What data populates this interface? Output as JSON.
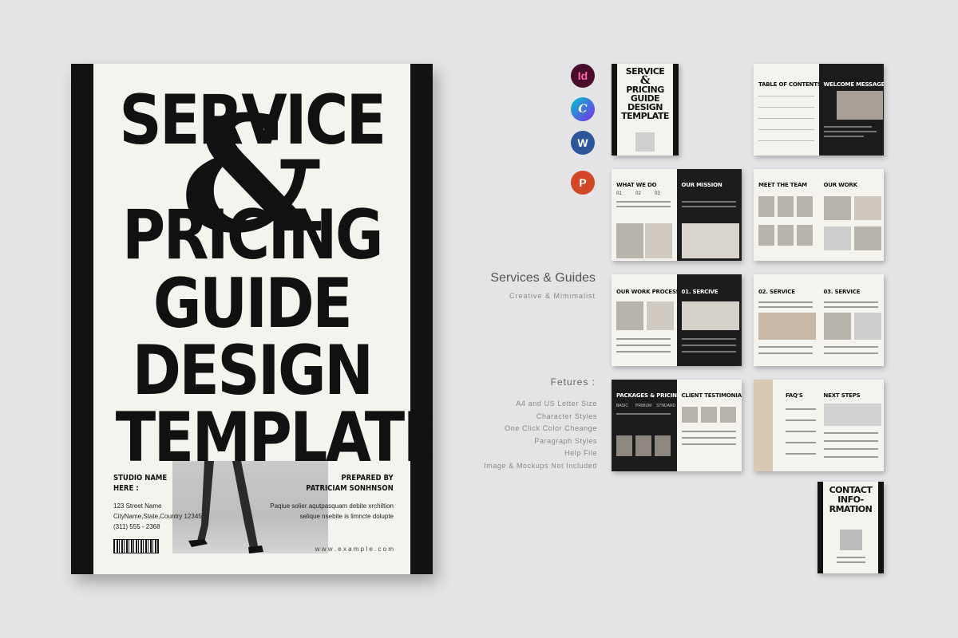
{
  "cover": {
    "title_line1": "SERVICE",
    "amp": "&",
    "title_line2": "PRICING",
    "title_line3": "GUIDE",
    "title_line4": "DESIGN",
    "title_line5": "TEMPLATE",
    "studio_label_1": "STUDIO NAME",
    "studio_label_2": "HERE :",
    "address_1": "123 Street Name",
    "address_2": "CityName,State,Country 12345",
    "phone": "(311) 555 - 2368",
    "prepared_by": "PREPARED BY",
    "author": "PATRICIAM SONHNSON",
    "lorem_1": "Paqiue solier aqutpasquam debite xrchiltion",
    "lorem_2": "selique nsebite is limncte dolupte",
    "website": "w w w . e x a m p l e . c o m"
  },
  "apps": [
    {
      "name": "indesign-icon",
      "label": "Id",
      "color": "#4a0d2a"
    },
    {
      "name": "canva-icon",
      "label": "C",
      "color": "#3b6fe0"
    },
    {
      "name": "word-icon",
      "label": "W",
      "color": "#2b579a"
    },
    {
      "name": "powerpoint-icon",
      "label": "P",
      "color": "#d24726"
    }
  ],
  "product": {
    "title": "Services & Guides",
    "subtitle": "Creative & Mimimalist"
  },
  "features": {
    "heading": "Fetures :",
    "items": [
      "A4 and US Letter Size",
      "Character Styles",
      "One Click Color Cheange",
      "Paragraph Styles",
      "Help File",
      "Image & Mockups Not Included"
    ]
  },
  "thumbs": {
    "mini_cover": [
      "SERVICE",
      "&",
      "PRICING",
      "GUIDE",
      "DESIGN",
      "TEMPLATE"
    ],
    "toc": "TABLE OF CONTENTS",
    "welcome": "WELCOME MESSAGE",
    "what_we_do": "WHAT WE DO",
    "our_mission": "OUR MISSION",
    "meet_team": "MEET THE TEAM",
    "our_work": "OUR WORK",
    "process": "OUR WORK PROCESS",
    "service1": "01. SERCIVE",
    "service2": "02. SERVICE",
    "service3": "03. SERVICE",
    "packages": "PACKAGES & PRICING",
    "testimonials": "CLIENT TESTIMONIALS",
    "faq": "FAQ'S",
    "next_steps": "NEXT STEPS",
    "contact_1": "CONTACT",
    "contact_2": "INFO-",
    "contact_3": "RMATION",
    "pkg_cols": [
      "BASIC",
      "PRMIUM",
      "STNDARD"
    ],
    "wwd_cols": [
      "01",
      "02",
      "03"
    ]
  }
}
